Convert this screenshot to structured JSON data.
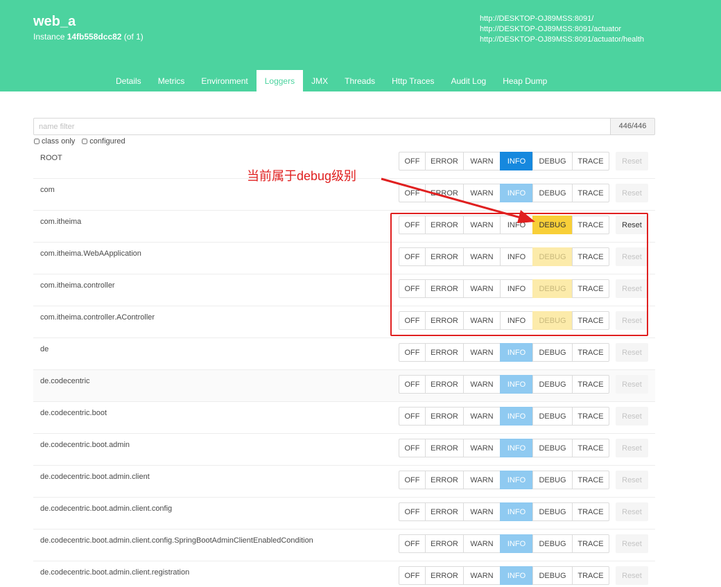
{
  "app": {
    "name": "web_a",
    "instance_prefix": "Instance ",
    "instance_id": "14fb558dcc82",
    "instance_suffix": " (of 1)"
  },
  "urls": [
    "http://DESKTOP-OJ89MSS:8091/",
    "http://DESKTOP-OJ89MSS:8091/actuator",
    "http://DESKTOP-OJ89MSS:8091/actuator/health"
  ],
  "tabs": [
    {
      "label": "Details"
    },
    {
      "label": "Metrics"
    },
    {
      "label": "Environment"
    },
    {
      "label": "Loggers",
      "active": true
    },
    {
      "label": "JMX"
    },
    {
      "label": "Threads"
    },
    {
      "label": "Http Traces"
    },
    {
      "label": "Audit Log"
    },
    {
      "label": "Heap Dump"
    }
  ],
  "filter": {
    "placeholder": "name filter",
    "value": "",
    "count": "446/446"
  },
  "checkboxes": {
    "class_only": "class only",
    "configured": "configured"
  },
  "levels": [
    "OFF",
    "ERROR",
    "WARN",
    "INFO",
    "DEBUG",
    "TRACE"
  ],
  "reset_label": "Reset",
  "loggers": [
    {
      "name": "ROOT",
      "level": "INFO",
      "configured": true
    },
    {
      "name": "com",
      "level": "INFO",
      "configured": false
    },
    {
      "name": "com.itheima",
      "level": "DEBUG",
      "configured": true
    },
    {
      "name": "com.itheima.WebAApplication",
      "level": "DEBUG",
      "configured": false
    },
    {
      "name": "com.itheima.controller",
      "level": "DEBUG",
      "configured": false
    },
    {
      "name": "com.itheima.controller.AController",
      "level": "DEBUG",
      "configured": false
    },
    {
      "name": "de",
      "level": "INFO",
      "configured": false
    },
    {
      "name": "de.codecentric",
      "level": "INFO",
      "configured": false
    },
    {
      "name": "de.codecentric.boot",
      "level": "INFO",
      "configured": false
    },
    {
      "name": "de.codecentric.boot.admin",
      "level": "INFO",
      "configured": false
    },
    {
      "name": "de.codecentric.boot.admin.client",
      "level": "INFO",
      "configured": false
    },
    {
      "name": "de.codecentric.boot.admin.client.config",
      "level": "INFO",
      "configured": false
    },
    {
      "name": "de.codecentric.boot.admin.client.config.SpringBootAdminClientEnabledCondition",
      "level": "INFO",
      "configured": false
    },
    {
      "name": "de.codecentric.boot.admin.client.registration",
      "level": "INFO",
      "configured": false
    }
  ],
  "annotation": {
    "text": "当前属于debug级别"
  },
  "colors": {
    "header": "#4cd39f",
    "info_active": "#1688de",
    "info_inherited": "#8fcaf1",
    "debug_active": "#f8cf38",
    "debug_inherited": "#fcebaa",
    "annotation": "#e02020"
  }
}
